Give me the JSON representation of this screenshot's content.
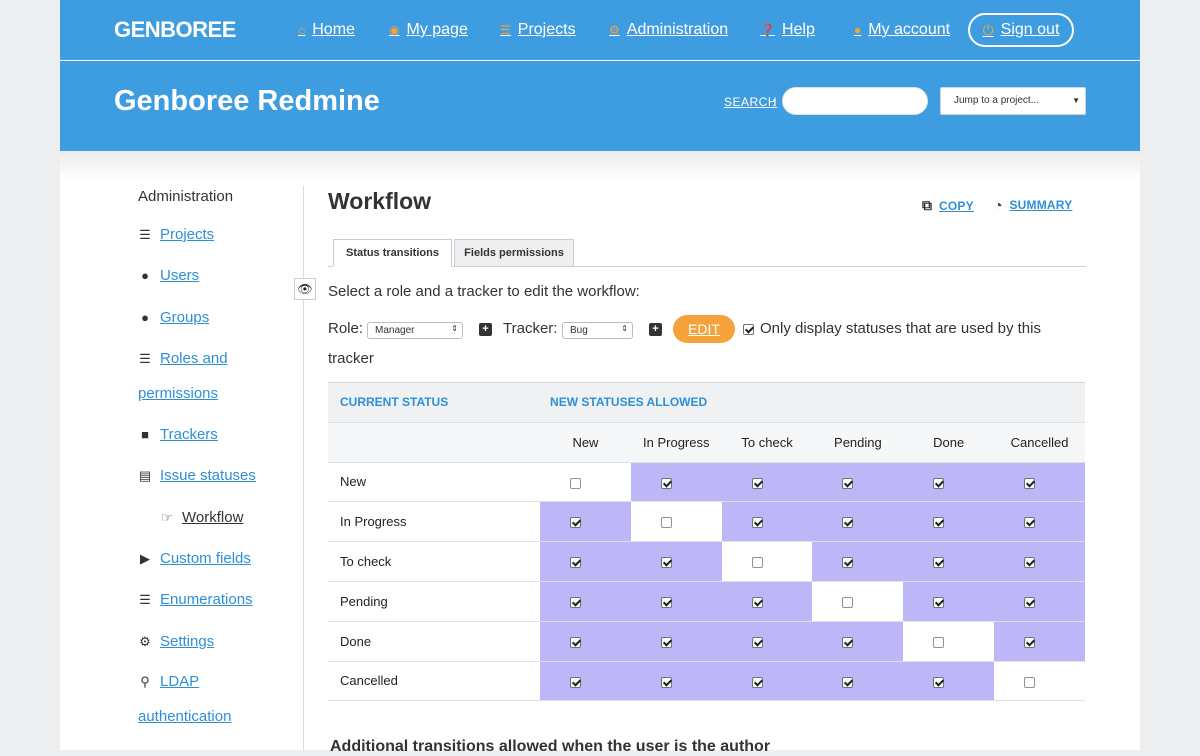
{
  "topbar": {
    "logo": "GENBOREE",
    "nav": [
      {
        "label": "Home",
        "icon": "home-icon"
      },
      {
        "label": "My page",
        "icon": "dashboard-icon"
      },
      {
        "label": "Projects",
        "icon": "list-icon"
      },
      {
        "label": "Administration",
        "icon": "gear-icon"
      },
      {
        "label": "Help",
        "icon": "help-icon"
      },
      {
        "label": "My account",
        "icon": "user-icon"
      }
    ],
    "signout": "Sign out"
  },
  "header": {
    "title": "Genboree Redmine",
    "search_label": "SEARCH",
    "search_value": "",
    "jump_label": "Jump to a project..."
  },
  "sidebar": {
    "title": "Administration",
    "items": [
      {
        "label": "Projects",
        "icon": "list-icon"
      },
      {
        "label": "Users",
        "icon": "user-icon"
      },
      {
        "label": "Groups",
        "icon": "group-icon"
      },
      {
        "label": "Roles and",
        "label2": "permissions",
        "icon": "database-icon"
      },
      {
        "label": "Trackers",
        "icon": "square-icon"
      },
      {
        "label": "Issue statuses",
        "icon": "document-icon"
      },
      {
        "label": "Workflow",
        "icon": "hand-pointer-icon"
      },
      {
        "label": "Custom fields",
        "icon": "play-square-icon"
      },
      {
        "label": "Enumerations",
        "icon": "numbered-list-icon"
      },
      {
        "label": "Settings",
        "icon": "cog-icon"
      },
      {
        "label": "LDAP",
        "label2": "authentication",
        "icon": "key-icon"
      }
    ]
  },
  "main": {
    "title": "Workflow",
    "copy_label": "COPY",
    "summary_label": "SUMMARY",
    "tabs": [
      "Status transitions",
      "Fields permissions"
    ],
    "instruction": "Select a role and a tracker to edit the workflow:",
    "role_label": "Role:",
    "role_value": "Manager",
    "tracker_label": "Tracker:",
    "tracker_value": "Bug",
    "edit_label": "EDIT",
    "only_used_label": "Only display statuses that are used by this",
    "only_used_label2": "tracker",
    "only_used_checked": true
  },
  "workflow": {
    "current_status_header": "CURRENT STATUS",
    "new_statuses_header": "NEW STATUSES ALLOWED",
    "columns": [
      "New",
      "In Progress",
      "To check",
      "Pending",
      "Done",
      "Cancelled"
    ],
    "rows": [
      {
        "status": "New",
        "allowed": [
          false,
          true,
          true,
          true,
          true,
          true
        ]
      },
      {
        "status": "In Progress",
        "allowed": [
          true,
          false,
          true,
          true,
          true,
          true
        ]
      },
      {
        "status": "To check",
        "allowed": [
          true,
          true,
          false,
          true,
          true,
          true
        ]
      },
      {
        "status": "Pending",
        "allowed": [
          true,
          true,
          true,
          false,
          true,
          true
        ]
      },
      {
        "status": "Done",
        "allowed": [
          true,
          true,
          true,
          true,
          false,
          true
        ]
      },
      {
        "status": "Cancelled",
        "allowed": [
          true,
          true,
          true,
          true,
          true,
          false
        ]
      }
    ],
    "highlight_color": "#bdb6f7"
  },
  "footer_heading": "Additional transitions allowed when the user is the author",
  "colors": {
    "brand_blue": "#3d9de0",
    "accent_orange": "#f6a23a",
    "link_blue": "#2f8fd6"
  }
}
